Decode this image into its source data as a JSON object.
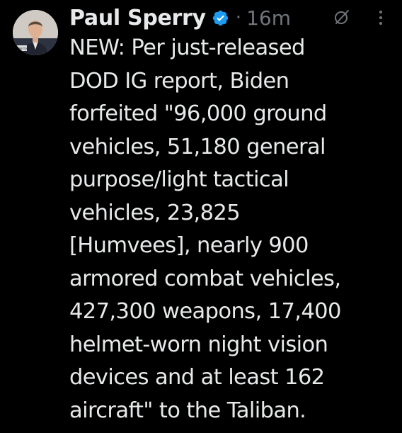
{
  "author": {
    "display_name": "Paul Sperry",
    "verified": true,
    "avatar_caption": "Sperry",
    "verified_color": "#1d9bf0"
  },
  "meta": {
    "separator": "·",
    "timestamp": "16m"
  },
  "icons": {
    "grok": "grok-icon",
    "more": "more-options-icon",
    "verified": "verified-badge-icon"
  },
  "tweet": {
    "lines": [
      "NEW: Per just-released",
      "DOD IG report, Biden",
      "forfeited \"96,000 ground",
      "vehicles, 51,180 general",
      "purpose/light tactical",
      "vehicles, 23,825",
      "[Humvees], nearly 900",
      "armored combat vehicles,",
      "427,300 weapons, 17,400",
      "helmet-worn night vision",
      "devices and at least 162",
      "aircraft\" to the Taliban."
    ]
  },
  "colors": {
    "background": "#000000",
    "text": "#e7e9ea",
    "secondary": "#71767b"
  }
}
